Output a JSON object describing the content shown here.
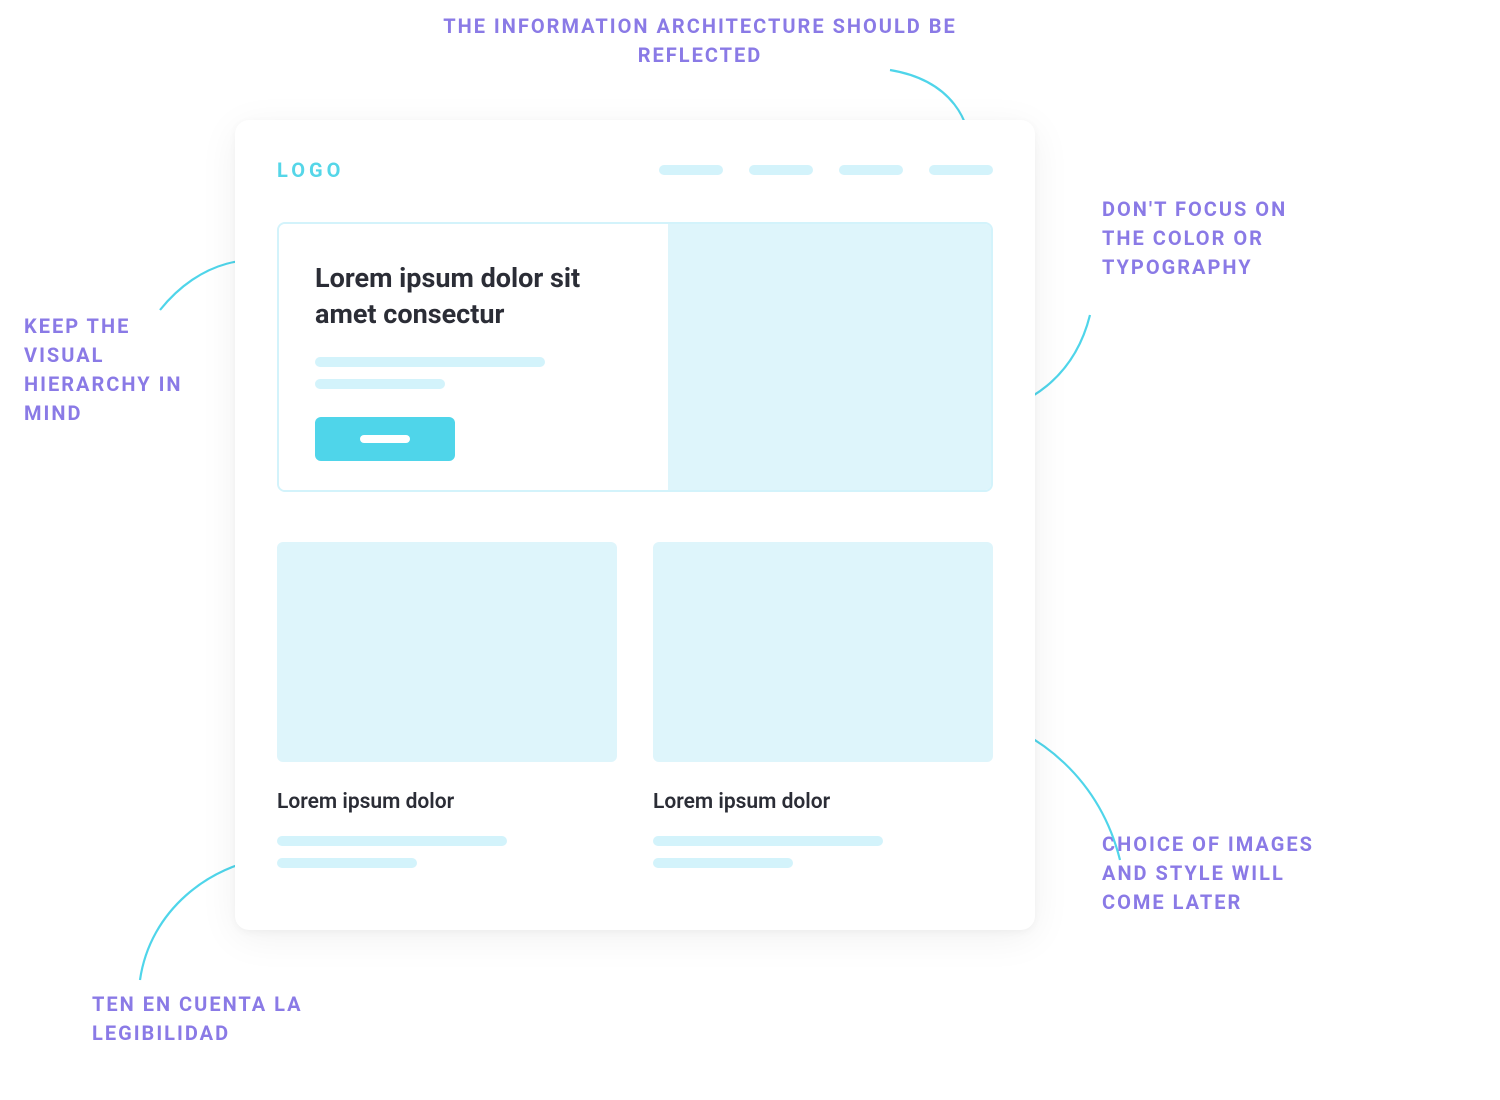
{
  "annotations": {
    "top": "THE INFORMATION ARCHITECTURE SHOULD BE REFLECTED",
    "left1": "KEEP THE VISUAL HIERARCHY IN MIND",
    "right1": "DON'T FOCUS ON THE COLOR OR TYPOGRAPHY",
    "right2": "CHOICE OF IMAGES AND STYLE WILL COME LATER",
    "left2": "TEN EN CUENTA LA LEGIBILIDAD"
  },
  "wireframe": {
    "logo": "LOGO",
    "hero_title": "Lorem ipsum dolor sit amet consectur",
    "cards": [
      {
        "title": "Lorem ipsum dolor"
      },
      {
        "title": "Lorem ipsum dolor"
      }
    ]
  }
}
